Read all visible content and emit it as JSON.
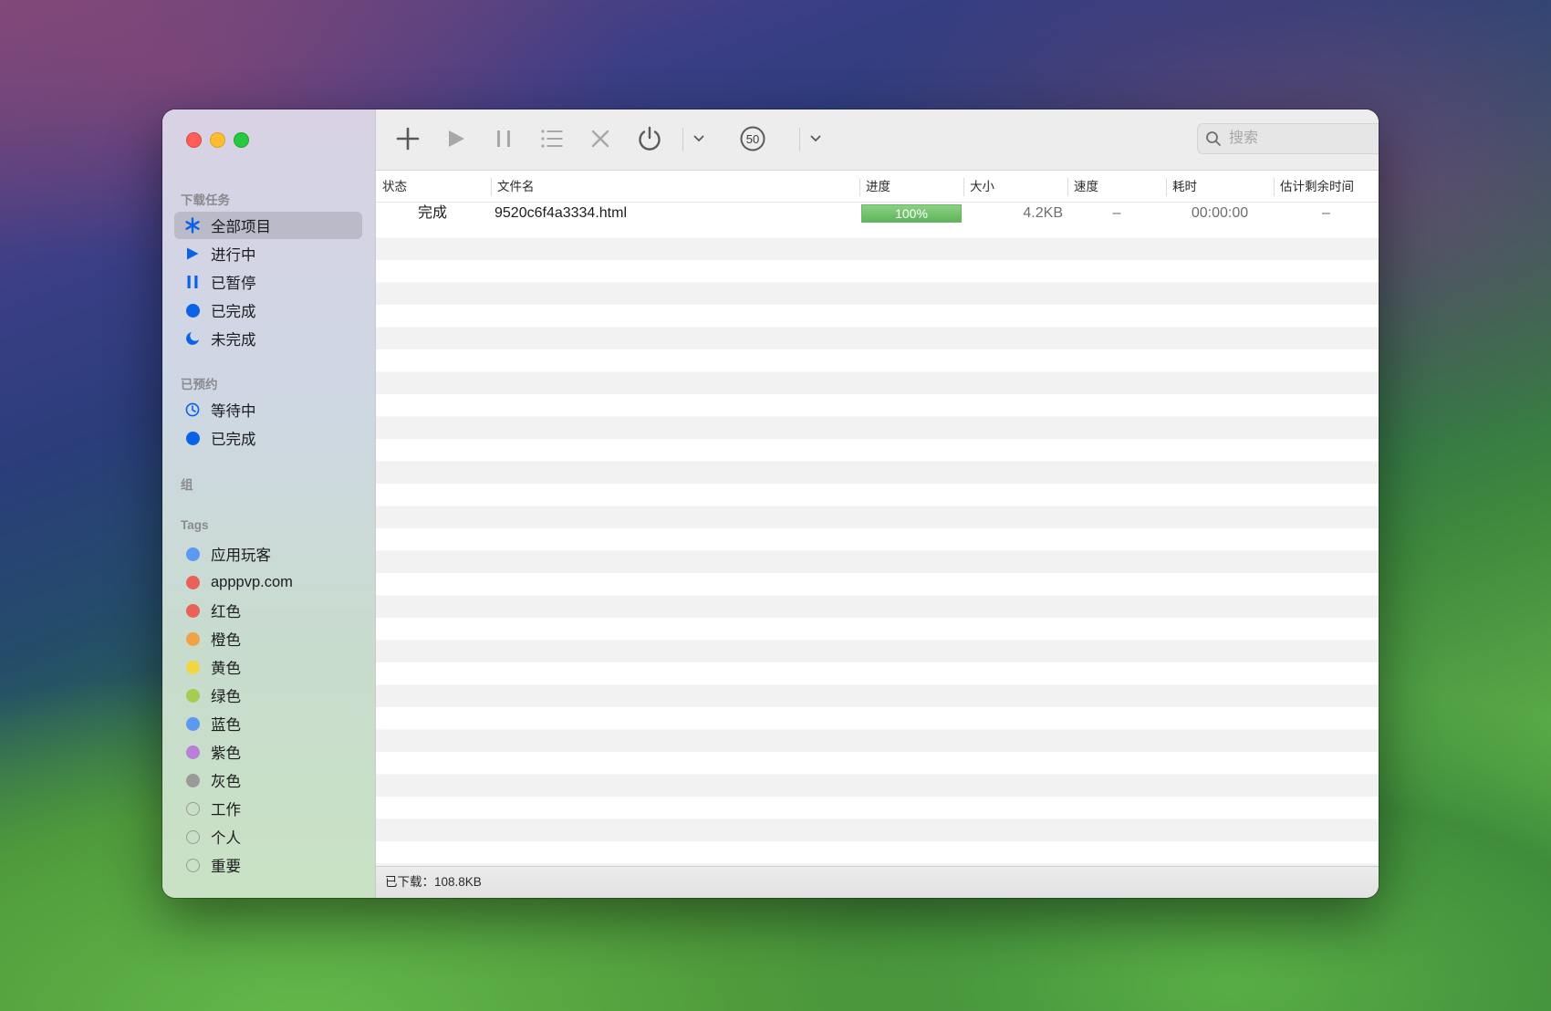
{
  "window": {
    "traffic_lights": [
      "close",
      "minimize",
      "zoom"
    ]
  },
  "toolbar": {
    "icons": [
      "add-icon",
      "play-icon",
      "pause-icon",
      "list-icon",
      "close-icon",
      "power-icon",
      "chevron-down-icon",
      "speed-limit-icon",
      "chevron-down-icon"
    ],
    "speed_limit_label": "50",
    "search_placeholder": "搜索"
  },
  "sidebar": {
    "sections": {
      "downloads": "下载任务",
      "scheduled": "已预约",
      "groups": "组",
      "tags": "Tags"
    },
    "download_items": [
      {
        "label": "全部项目",
        "icon": "asterisk-icon",
        "selected": true
      },
      {
        "label": "进行中",
        "icon": "play-icon"
      },
      {
        "label": "已暂停",
        "icon": "pause-icon"
      },
      {
        "label": "已完成",
        "icon": "filled-circle-icon"
      },
      {
        "label": "未完成",
        "icon": "moon-icon"
      }
    ],
    "scheduled_items": [
      {
        "label": "等待中",
        "icon": "clock-icon"
      },
      {
        "label": "已完成",
        "icon": "filled-circle-icon"
      }
    ],
    "tags": [
      {
        "label": "应用玩客",
        "color": "#5b9af0"
      },
      {
        "label": "apppvp.com",
        "color": "#e8625a"
      },
      {
        "label": "红色",
        "color": "#e8625a"
      },
      {
        "label": "橙色",
        "color": "#efa345"
      },
      {
        "label": "黄色",
        "color": "#f2d543"
      },
      {
        "label": "绿色",
        "color": "#a8cb52"
      },
      {
        "label": "蓝色",
        "color": "#5b9af0"
      },
      {
        "label": "紫色",
        "color": "#b681d6"
      },
      {
        "label": "灰色",
        "color": "#9a9a9a"
      },
      {
        "label": "工作",
        "color": ""
      },
      {
        "label": "个人",
        "color": ""
      },
      {
        "label": "重要",
        "color": ""
      }
    ]
  },
  "table": {
    "columns": [
      "状态",
      "文件名",
      "进度",
      "大小",
      "速度",
      "耗时",
      "估计剩余时间"
    ],
    "rows": [
      {
        "status": "完成",
        "filename": "9520c6f4a3334.html",
        "progress": "100%",
        "progress_value": 1.0,
        "size": "4.2KB",
        "speed": "–",
        "elapsed": "00:00:00",
        "remaining": "–"
      }
    ]
  },
  "statusbar": {
    "downloaded": "已下载：108.8KB"
  },
  "colors": {
    "accent": "#0a63e6",
    "progress": "#5fb55a"
  }
}
